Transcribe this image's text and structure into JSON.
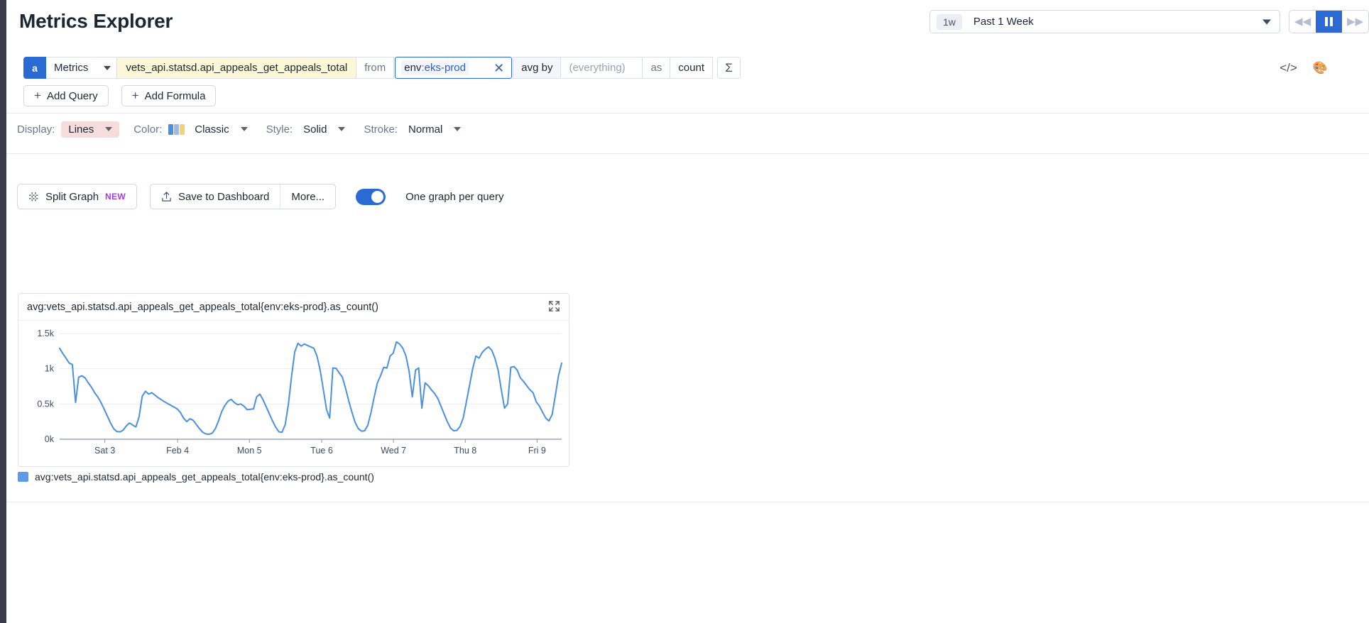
{
  "header": {
    "title": "Metrics Explorer"
  },
  "timepicker": {
    "badge": "1w",
    "label": "Past 1 Week",
    "caret_icon": "chevron-down-icon",
    "rewind_icon": "rewind-icon",
    "pause_icon": "pause-icon",
    "forward_icon": "fast-forward-icon"
  },
  "query": {
    "letter": "a",
    "source": "Metrics",
    "metric": "vets_api.statsd.api_appeals_get_appeals_total",
    "from_label": "from",
    "tag_key": "env",
    "tag_sep": ":",
    "tag_value": "eks-prod",
    "clear_icon": "close-icon",
    "group_label": "avg by",
    "group_value": "(everything)",
    "as_label": "as",
    "as_value": "count",
    "sigma_icon": "sigma-icon",
    "code_icon": "code-brackets-icon",
    "palette_icon": "color-palette-icon"
  },
  "add_buttons": {
    "add_query": "Add Query",
    "add_formula": "Add Formula",
    "plus_icon": "plus-icon"
  },
  "display_options": {
    "display_label": "Display:",
    "display_value": "Lines",
    "color_label": "Color:",
    "color_value": "Classic",
    "color_swatch": [
      "#4a90e2",
      "#9fb8e8",
      "#f3d07a"
    ],
    "style_label": "Style:",
    "style_value": "Solid",
    "stroke_label": "Stroke:",
    "stroke_value": "Normal"
  },
  "actions": {
    "split_graph": "Split Graph",
    "split_graph_badge": "NEW",
    "split_icon": "split-graph-icon",
    "save_to_dashboard": "Save to Dashboard",
    "upload_icon": "upload-icon",
    "more": "More...",
    "toggle_label": "One graph per query",
    "toggle_on": true
  },
  "graph": {
    "title": "avg:vets_api.statsd.api_appeals_get_appeals_total{env:eks-prod}.as_count()",
    "expand_icon": "expand-icon",
    "legend_label": "avg:vets_api.statsd.api_appeals_get_appeals_total{env:eks-prod}.as_count()",
    "legend_color": "#5b9bea"
  },
  "chart_data": {
    "type": "line",
    "title": "avg:vets_api.statsd.api_appeals_get_appeals_total{env:eks-prod}.as_count()",
    "xlabel": "",
    "ylabel": "",
    "ylim": [
      0,
      1600
    ],
    "ytick_labels": [
      "0k",
      "0.5k",
      "1k",
      "1.5k"
    ],
    "ytick_values": [
      0,
      500,
      1000,
      1500
    ],
    "xtick_labels": [
      "Sat 3",
      "Feb 4",
      "Mon 5",
      "Tue 6",
      "Wed 7",
      "Thu 8",
      "Fri 9"
    ],
    "xtick_positions": [
      0.09,
      0.235,
      0.378,
      0.522,
      0.665,
      0.808,
      0.951
    ],
    "grid": true,
    "legend_position": "bottom",
    "series": [
      {
        "name": "avg:vets_api.statsd.api_appeals_get_appeals_total{env:eks-prod}.as_count()",
        "color": "#4a90e2",
        "values": [
          1290,
          1215,
          1150,
          1080,
          1060,
          520,
          880,
          900,
          870,
          800,
          740,
          660,
          600,
          520,
          430,
          330,
          230,
          150,
          110,
          105,
          130,
          190,
          230,
          200,
          175,
          320,
          610,
          680,
          640,
          660,
          625,
          590,
          560,
          530,
          505,
          480,
          455,
          430,
          380,
          300,
          250,
          290,
          270,
          210,
          150,
          100,
          75,
          70,
          85,
          150,
          260,
          390,
          480,
          540,
          565,
          520,
          490,
          500,
          470,
          420,
          425,
          430,
          600,
          640,
          560,
          460,
          360,
          260,
          170,
          105,
          100,
          210,
          500,
          900,
          1240,
          1360,
          1320,
          1350,
          1330,
          1310,
          1290,
          1180,
          980,
          700,
          420,
          300,
          1010,
          1005,
          940,
          880,
          720,
          540,
          380,
          240,
          150,
          115,
          120,
          200,
          380,
          600,
          800,
          900,
          1020,
          1010,
          1180,
          1220,
          1380,
          1350,
          1290,
          1180,
          960,
          600,
          980,
          1010,
          440,
          800,
          760,
          700,
          650,
          580,
          470,
          360,
          250,
          160,
          120,
          125,
          180,
          300,
          530,
          760,
          1000,
          1180,
          1150,
          1230,
          1280,
          1310,
          1260,
          1150,
          980,
          700,
          440,
          500,
          1020,
          1030,
          980,
          870,
          820,
          760,
          700,
          660,
          530,
          470,
          380,
          300,
          260,
          350,
          620,
          900,
          1080
        ]
      }
    ]
  }
}
